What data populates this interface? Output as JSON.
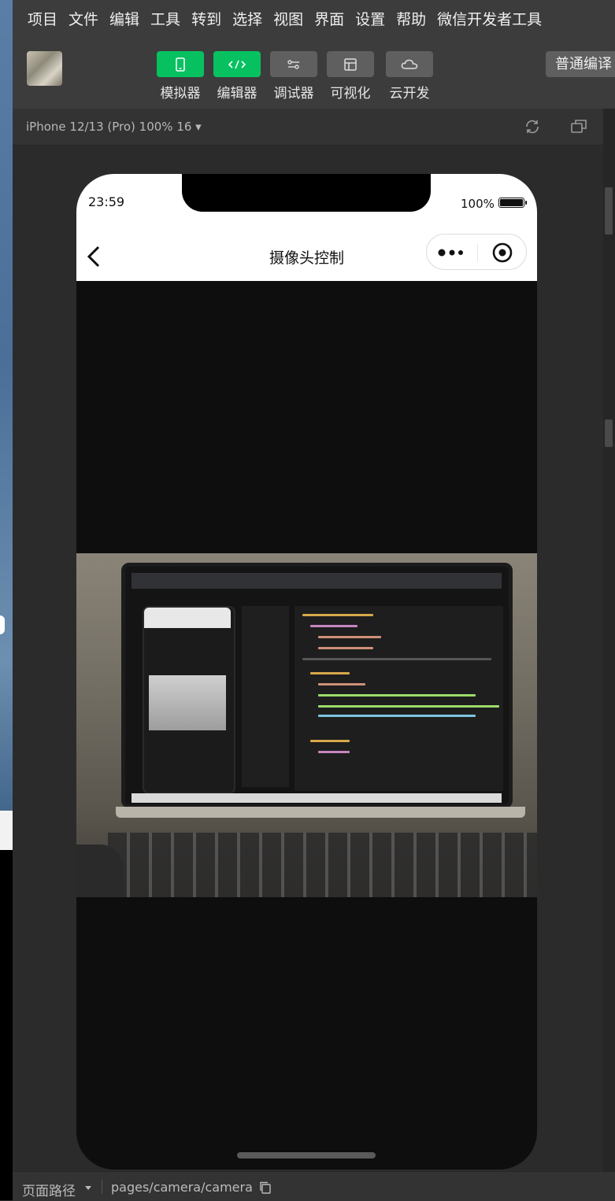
{
  "menu": {
    "items": [
      "项目",
      "文件",
      "编辑",
      "工具",
      "转到",
      "选择",
      "视图",
      "界面",
      "设置",
      "帮助",
      "微信开发者工具"
    ]
  },
  "toolbar": {
    "tools": [
      {
        "label": "模拟器",
        "icon": "phone-icon",
        "active": true
      },
      {
        "label": "编辑器",
        "icon": "code-icon",
        "active": true
      },
      {
        "label": "调试器",
        "icon": "debug-icon",
        "active": false
      },
      {
        "label": "可视化",
        "icon": "layout-icon",
        "active": false
      },
      {
        "label": "云开发",
        "icon": "cloud-icon",
        "active": false
      }
    ],
    "compile_label": "普通编译"
  },
  "simulator": {
    "device": "iPhone 12/13 (Pro) 100% 16 ▾"
  },
  "phone": {
    "time": "23:59",
    "battery_text": "100%",
    "battery_level": 1.0,
    "title": "摄像头控制"
  },
  "bottom": {
    "path_label": "页面路径",
    "path": "pages/camera/camera"
  },
  "colors": {
    "accent": "#07c160",
    "menubar": "#3c3c3c",
    "panel": "#2e2e2e"
  }
}
